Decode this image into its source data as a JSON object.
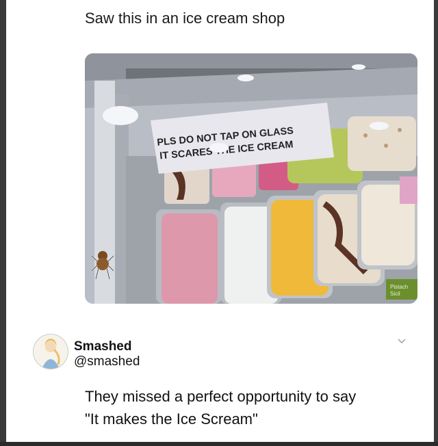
{
  "post": {
    "text": "Saw this in an ice cream shop"
  },
  "photo": {
    "sign_line1": "PLS DO NOT TAP ON GLASS",
    "sign_line2": "IT SCARES THE ICE CREAM",
    "label_text": "Pistach Sicil",
    "content_icon": "spider-emoji-icon"
  },
  "reply": {
    "name": "Smashed",
    "handle": "@smashed",
    "text_line1": "They missed a perfect opportunity to say",
    "text_line2": "\"It makes the Ice Scream\"",
    "avatar_icon": "avatar-cartoon-icon",
    "menu_icon": "chevron-down-icon"
  }
}
